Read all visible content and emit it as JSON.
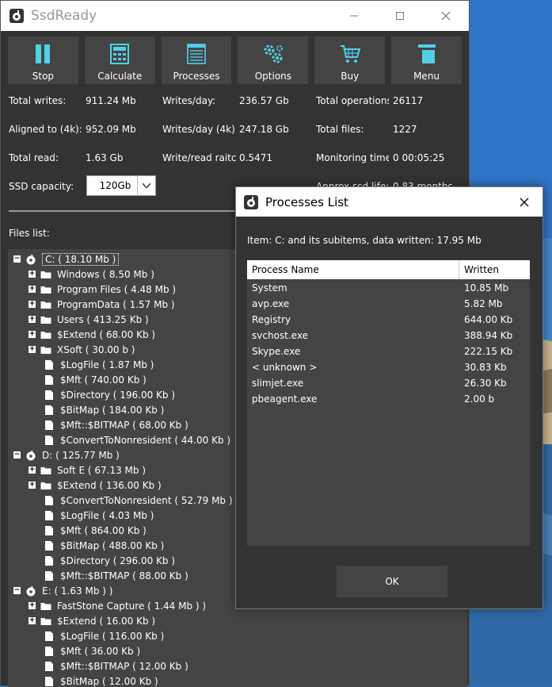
{
  "app": {
    "title": "SsdReady"
  },
  "toolbar": [
    {
      "label": "Stop",
      "icon": "pause-icon"
    },
    {
      "label": "Calculate",
      "icon": "calculator-icon"
    },
    {
      "label": "Processes",
      "icon": "list-icon"
    },
    {
      "label": "Options",
      "icon": "gears-icon"
    },
    {
      "label": "Buy",
      "icon": "cart-icon"
    },
    {
      "label": "Menu",
      "icon": "menu-icon"
    }
  ],
  "stats": {
    "total_writes_label": "Total writes:",
    "total_writes": "911.24 Mb",
    "writes_day_label": "Writes/day:",
    "writes_day": "236.57 Gb",
    "total_ops_label": "Total operations",
    "total_ops": "26117",
    "aligned_label": "Aligned to (4k):",
    "aligned": "952.09 Mb",
    "writes_day_4k_label": "Writes/day (4k)",
    "writes_day_4k": "247.18 Gb",
    "total_files_label": "Total files:",
    "total_files": "1227",
    "total_read_label": "Total read:",
    "total_read": "1.63 Gb",
    "write_read_ratio_label": "Write/read raitc",
    "write_read_ratio": "0.5471",
    "monitoring_label": "Monitoring time",
    "monitoring": "0 00:05:25",
    "capacity_label": "SSD capacity:",
    "capacity_value": "120Gb",
    "approx_life_label": "Approx ssd life:",
    "approx_life": "0.83 months"
  },
  "files_label": "Files list:",
  "tree": [
    {
      "text": "C: ( 18.10 Mb )",
      "level": 0,
      "exp": "−",
      "icon": "drive"
    },
    {
      "text": "Windows ( 8.50 Mb )",
      "level": 1,
      "exp": "+",
      "icon": "folder"
    },
    {
      "text": "Program Files ( 4.48 Mb )",
      "level": 1,
      "exp": "+",
      "icon": "folder"
    },
    {
      "text": "ProgramData ( 1.57 Mb )",
      "level": 1,
      "exp": "+",
      "icon": "folder"
    },
    {
      "text": "Users ( 413.25 Kb )",
      "level": 1,
      "exp": "+",
      "icon": "folder"
    },
    {
      "text": "$Extend ( 68.00 Kb )",
      "level": 1,
      "exp": "+",
      "icon": "folder"
    },
    {
      "text": "XSoft ( 30.00 b )",
      "level": 1,
      "exp": "+",
      "icon": "folder"
    },
    {
      "text": "$LogFile ( 1.87 Mb )",
      "level": 1,
      "exp": "",
      "icon": "file"
    },
    {
      "text": "$Mft ( 740.00 Kb )",
      "level": 1,
      "exp": "",
      "icon": "file"
    },
    {
      "text": "$Directory ( 196.00 Kb )",
      "level": 1,
      "exp": "",
      "icon": "file"
    },
    {
      "text": "$BitMap ( 184.00 Kb )",
      "level": 1,
      "exp": "",
      "icon": "file"
    },
    {
      "text": "$Mft::$BITMAP ( 68.00 Kb )",
      "level": 1,
      "exp": "",
      "icon": "file"
    },
    {
      "text": "$ConvertToNonresident ( 44.00 Kb )",
      "level": 1,
      "exp": "",
      "icon": "file"
    },
    {
      "text": "D: ( 125.77 Mb )",
      "level": 0,
      "exp": "−",
      "icon": "drive"
    },
    {
      "text": "Soft E ( 67.13 Mb )",
      "level": 1,
      "exp": "+",
      "icon": "folder"
    },
    {
      "text": "$Extend ( 136.00 Kb )",
      "level": 1,
      "exp": "+",
      "icon": "folder"
    },
    {
      "text": "$ConvertToNonresident ( 52.79 Mb )",
      "level": 1,
      "exp": "",
      "icon": "file"
    },
    {
      "text": "$LogFile ( 4.03 Mb )",
      "level": 1,
      "exp": "",
      "icon": "file"
    },
    {
      "text": "$Mft ( 864.00 Kb )",
      "level": 1,
      "exp": "",
      "icon": "file"
    },
    {
      "text": "$BitMap ( 488.00 Kb )",
      "level": 1,
      "exp": "",
      "icon": "file"
    },
    {
      "text": "$Directory ( 296.00 Kb )",
      "level": 1,
      "exp": "",
      "icon": "file"
    },
    {
      "text": "$Mft::$BITMAP ( 88.00 Kb )",
      "level": 1,
      "exp": "",
      "icon": "file"
    },
    {
      "text": "E: ( 1.63 Mb ) )",
      "level": 0,
      "exp": "−",
      "icon": "drive"
    },
    {
      "text": "FastStone Capture ( 1.44 Mb ) )",
      "level": 1,
      "exp": "+",
      "icon": "folder"
    },
    {
      "text": "$Extend ( 16.00 Kb )",
      "level": 1,
      "exp": "+",
      "icon": "folder"
    },
    {
      "text": "$LogFile ( 116.00 Kb )",
      "level": 1,
      "exp": "",
      "icon": "file"
    },
    {
      "text": "$Mft ( 36.00 Kb )",
      "level": 1,
      "exp": "",
      "icon": "file"
    },
    {
      "text": "$Mft::$BITMAP ( 12.00 Kb )",
      "level": 1,
      "exp": "",
      "icon": "file"
    },
    {
      "text": "$BitMap ( 12.00 Kb )",
      "level": 1,
      "exp": "",
      "icon": "file"
    }
  ],
  "dialog": {
    "title": "Processes List",
    "item_text": "Item: C: and its subitems, data written: 17.95 Mb",
    "col_process": "Process Name",
    "col_written": "Written",
    "rows": [
      {
        "name": "System",
        "written": "10.85 Mb"
      },
      {
        "name": "avp.exe",
        "written": "5.82 Mb"
      },
      {
        "name": "Registry",
        "written": "644.00 Kb"
      },
      {
        "name": "svchost.exe",
        "written": "388.94 Kb"
      },
      {
        "name": "Skype.exe",
        "written": "222.15 Kb"
      },
      {
        "name": "< unknown >",
        "written": "30.83 Kb"
      },
      {
        "name": "slimjet.exe",
        "written": "26.30 Kb"
      },
      {
        "name": "pbeagent.exe",
        "written": "2.00 b"
      }
    ],
    "ok_label": "OK"
  },
  "colors": {
    "accent": "#4fd1e6",
    "window_bg": "#333333",
    "panel_bg": "#444444"
  }
}
